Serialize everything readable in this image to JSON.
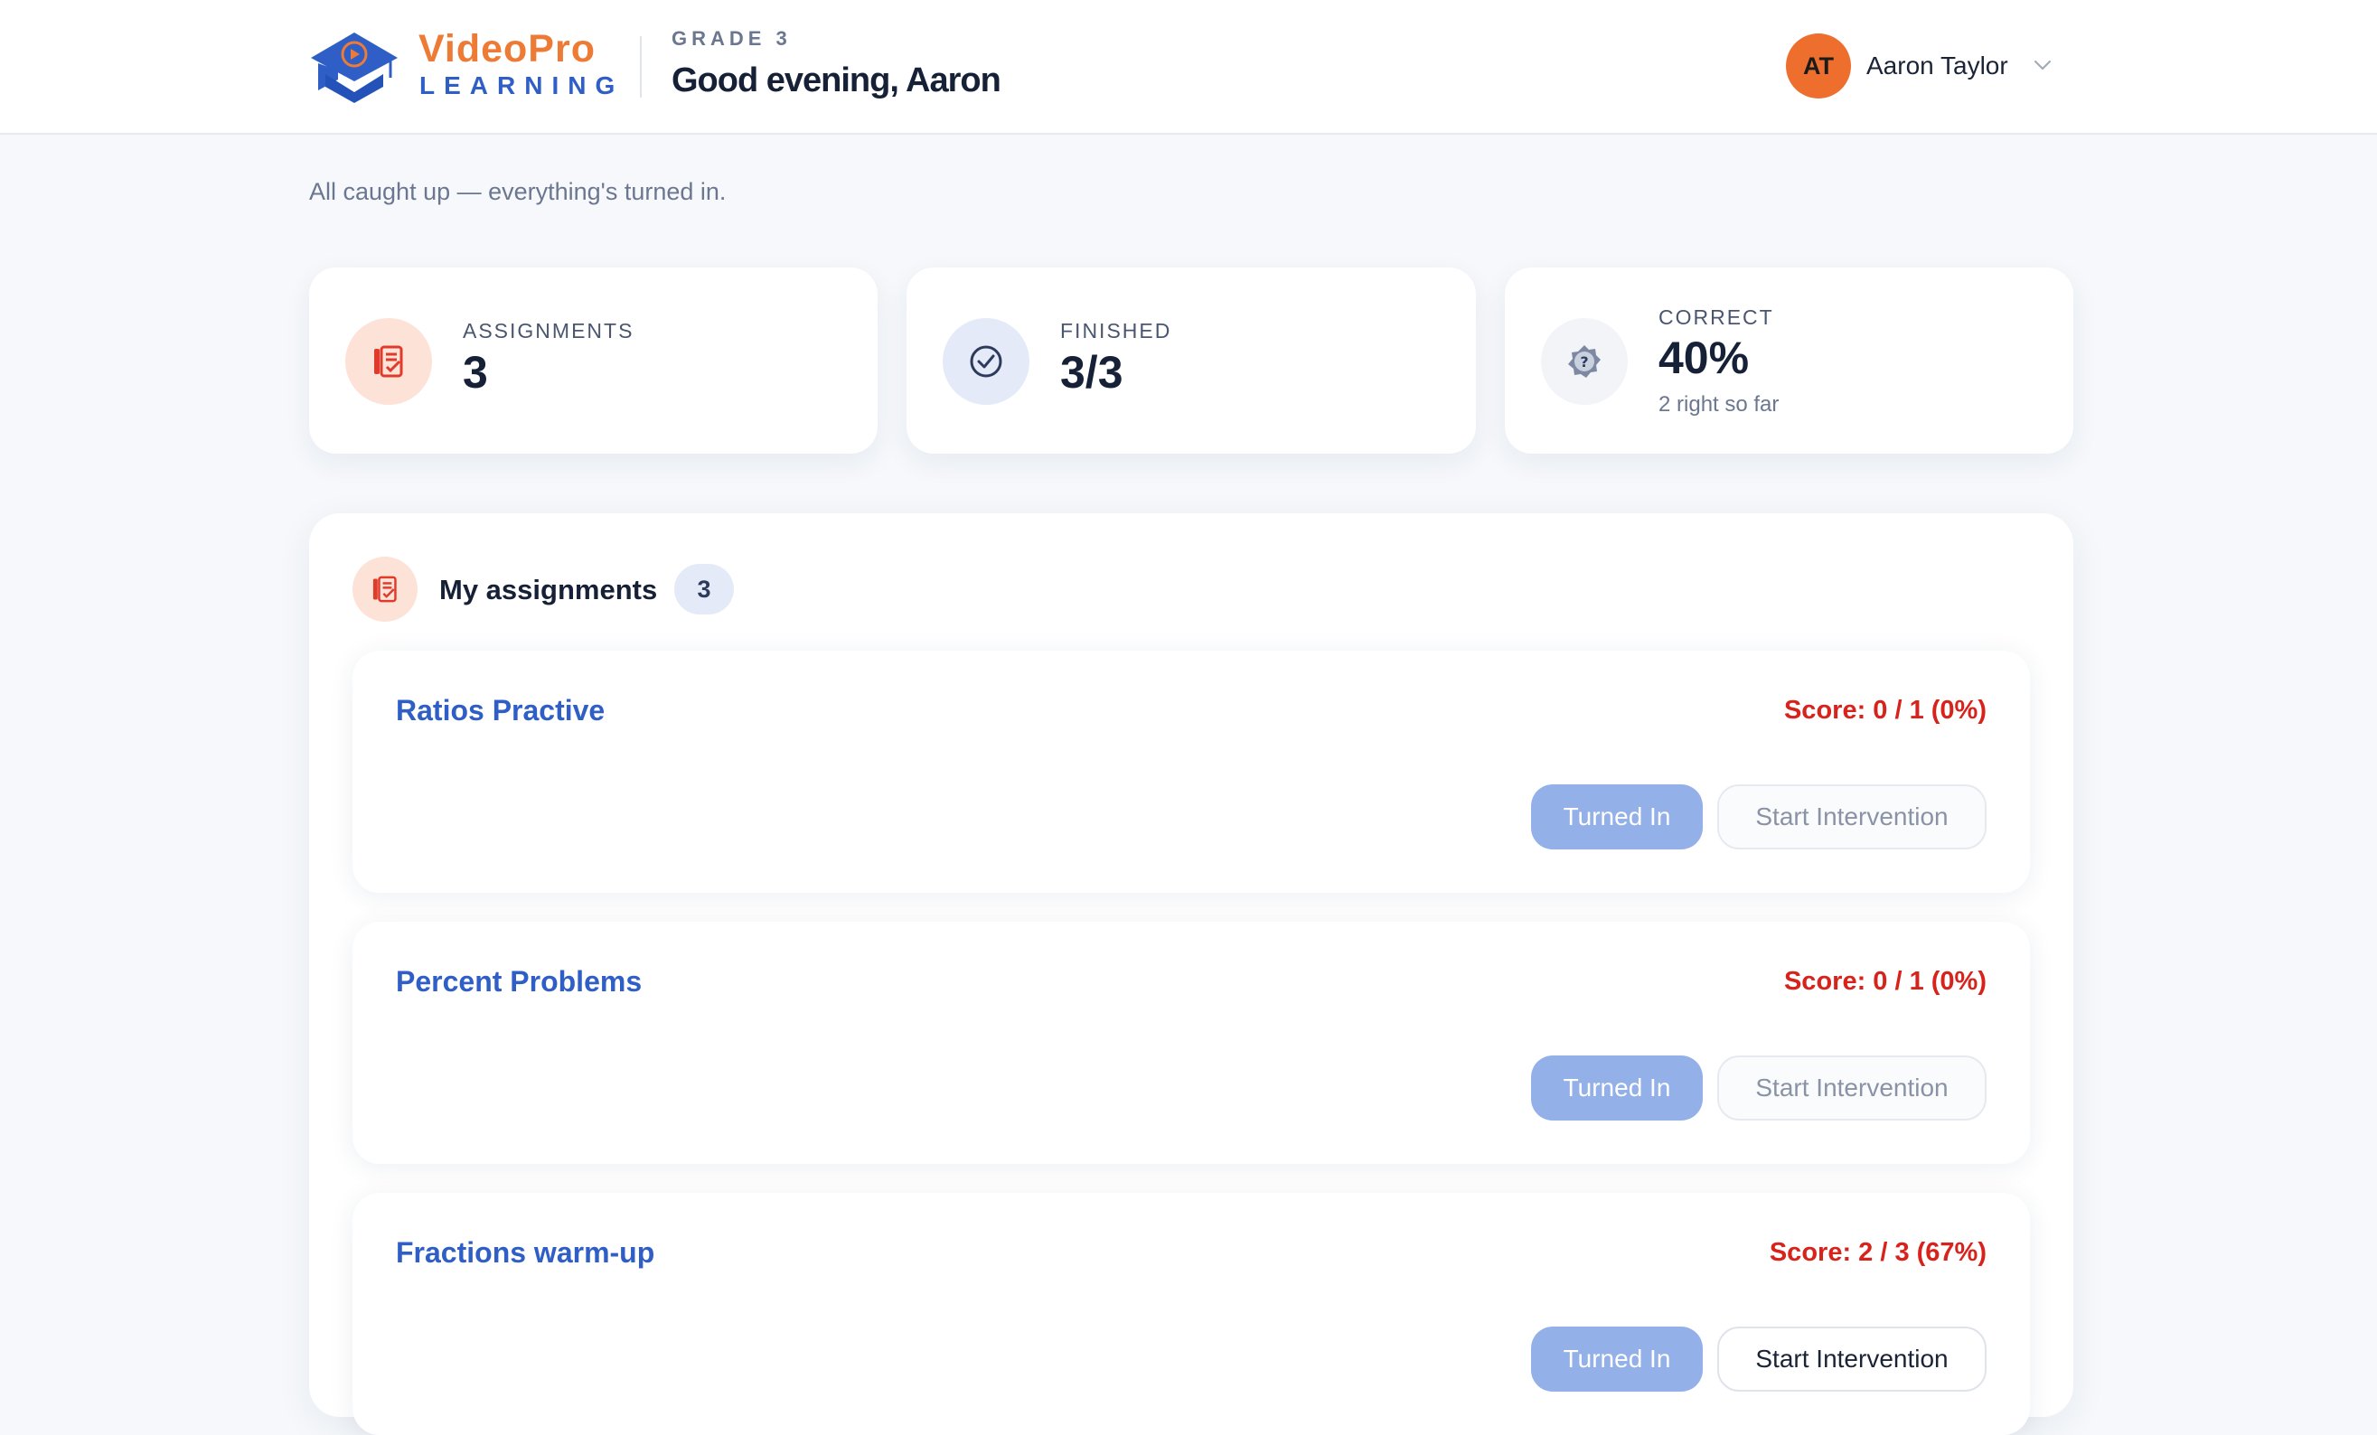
{
  "brand": {
    "name_top": "VideoPro",
    "name_bottom": "LEARNING"
  },
  "header": {
    "grade": "GRADE 3",
    "greeting": "Good evening, Aaron",
    "user": {
      "initials": "AT",
      "name": "Aaron Taylor"
    }
  },
  "status_message": "All caught up — everything's turned in.",
  "stats": [
    {
      "label": "ASSIGNMENTS",
      "value": "3",
      "icon": "assignment-list-icon"
    },
    {
      "label": "FINISHED",
      "value": "3/3",
      "icon": "check-circle-icon"
    },
    {
      "label": "CORRECT",
      "value": "40%",
      "note": "2 right so far",
      "icon": "question-badge-icon"
    }
  ],
  "assignments_panel": {
    "title": "My assignments",
    "count": "3",
    "items": [
      {
        "title": "Ratios Practive",
        "score": "Score: 0 / 1 (0%)",
        "turned_in_label": "Turned In",
        "intervention_label": "Start Intervention",
        "intervention_enabled": false
      },
      {
        "title": "Percent Problems",
        "score": "Score: 0 / 1 (0%)",
        "turned_in_label": "Turned In",
        "intervention_label": "Start Intervention",
        "intervention_enabled": false
      },
      {
        "title": "Fractions warm-up",
        "score": "Score: 2 / 3 (67%)",
        "turned_in_label": "Turned In",
        "intervention_label": "Start Intervention",
        "intervention_enabled": true
      }
    ]
  },
  "colors": {
    "brand_orange": "#ee7b35",
    "brand_blue": "#2f5fc6",
    "score_red": "#d8231c",
    "turned_in_button": "#93b0e8",
    "avatar": "#ee6f2d"
  }
}
